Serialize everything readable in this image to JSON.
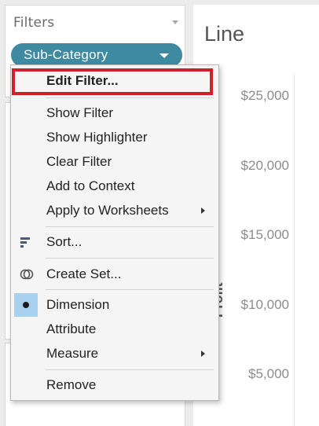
{
  "filters_panel": {
    "title": "Filters",
    "pill_label": "Sub-Category"
  },
  "chart": {
    "title": "Line",
    "y_axis_label": "Profit",
    "ticks": [
      "$25,000",
      "$20,000",
      "$15,000",
      "$10,000",
      "$5,000"
    ]
  },
  "context_menu": {
    "items": [
      {
        "label": "Edit Filter..."
      },
      {
        "label": "Show Filter"
      },
      {
        "label": "Show Highlighter"
      },
      {
        "label": "Clear Filter"
      },
      {
        "label": "Add to Context"
      },
      {
        "label": "Apply to Worksheets"
      },
      {
        "label": "Sort..."
      },
      {
        "label": "Create Set..."
      },
      {
        "label": "Dimension"
      },
      {
        "label": "Attribute"
      },
      {
        "label": "Measure"
      },
      {
        "label": "Remove"
      }
    ]
  },
  "colors": {
    "pill": "#3e8ba1",
    "highlight_border": "#d0202a",
    "selected_indicator": "#a8d0ef"
  },
  "icons": {
    "sort": "sort-icon",
    "create_set": "venn-set-icon",
    "dimension_selected": "bullet-dot-icon"
  }
}
